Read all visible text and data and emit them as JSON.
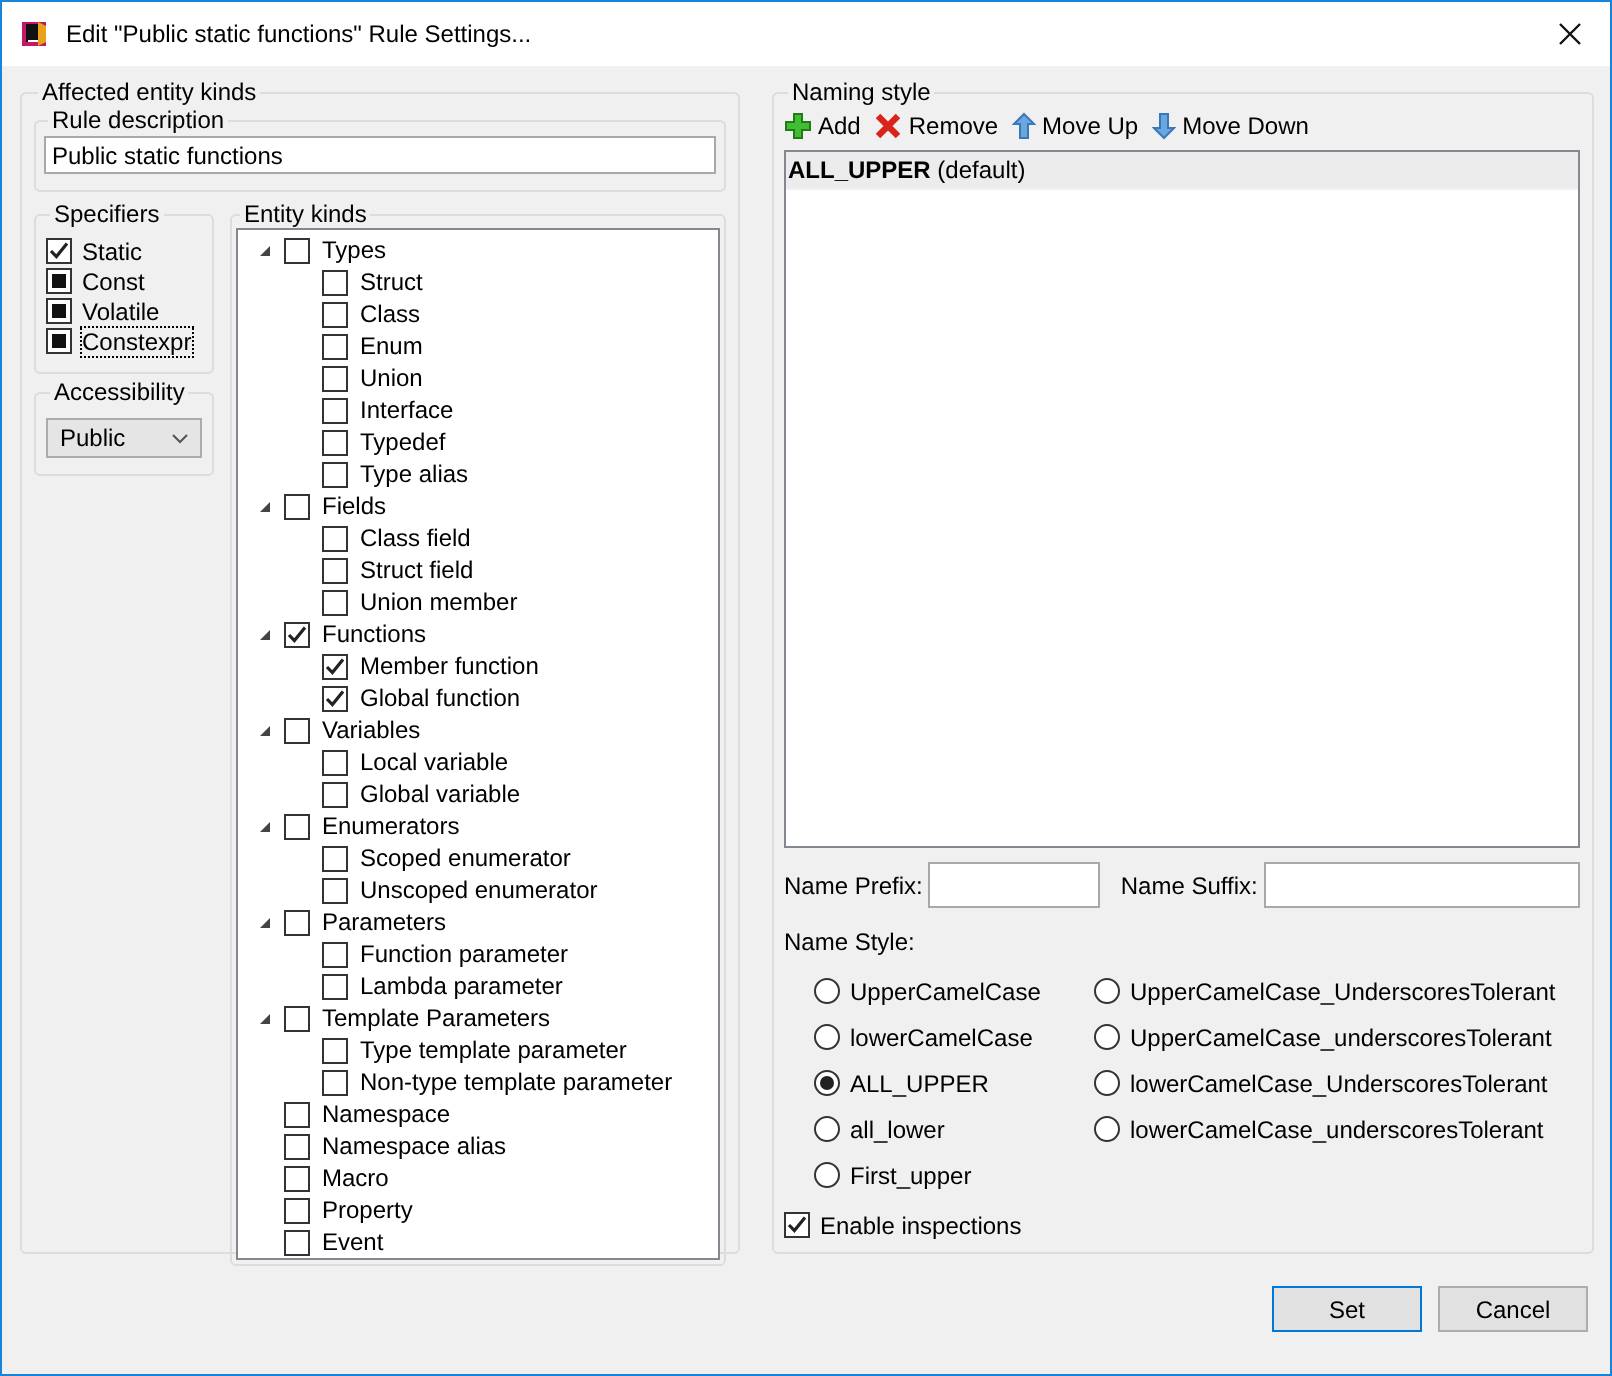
{
  "window": {
    "title": "Edit \"Public static functions\" Rule Settings..."
  },
  "affected": {
    "title": "Affected entity kinds",
    "rule_description": {
      "label": "Rule description",
      "value": "Public static functions"
    },
    "specifiers": {
      "title": "Specifiers",
      "items": [
        {
          "label": "Static",
          "checked": true,
          "focused": false
        },
        {
          "label": "Const",
          "checked": false,
          "indeterminate": true,
          "focused": false
        },
        {
          "label": "Volatile",
          "checked": false,
          "indeterminate": true,
          "focused": false
        },
        {
          "label": "Constexpr",
          "checked": false,
          "indeterminate": true,
          "focused": true
        }
      ]
    },
    "accessibility": {
      "title": "Accessibility",
      "value": "Public"
    },
    "entity_kinds": {
      "title": "Entity kinds",
      "items": [
        {
          "label": "Types",
          "checked": false,
          "expanded": true,
          "children": [
            {
              "label": "Struct",
              "checked": false
            },
            {
              "label": "Class",
              "checked": false
            },
            {
              "label": "Enum",
              "checked": false
            },
            {
              "label": "Union",
              "checked": false
            },
            {
              "label": "Interface",
              "checked": false
            },
            {
              "label": "Typedef",
              "checked": false
            },
            {
              "label": "Type alias",
              "checked": false
            }
          ]
        },
        {
          "label": "Fields",
          "checked": false,
          "expanded": true,
          "children": [
            {
              "label": "Class field",
              "checked": false
            },
            {
              "label": "Struct field",
              "checked": false
            },
            {
              "label": "Union member",
              "checked": false
            }
          ]
        },
        {
          "label": "Functions",
          "checked": true,
          "expanded": true,
          "children": [
            {
              "label": "Member function",
              "checked": true
            },
            {
              "label": "Global function",
              "checked": true
            }
          ]
        },
        {
          "label": "Variables",
          "checked": false,
          "expanded": true,
          "children": [
            {
              "label": "Local variable",
              "checked": false
            },
            {
              "label": "Global variable",
              "checked": false
            }
          ]
        },
        {
          "label": "Enumerators",
          "checked": false,
          "expanded": true,
          "children": [
            {
              "label": "Scoped enumerator",
              "checked": false
            },
            {
              "label": "Unscoped enumerator",
              "checked": false
            }
          ]
        },
        {
          "label": "Parameters",
          "checked": false,
          "expanded": true,
          "children": [
            {
              "label": "Function parameter",
              "checked": false
            },
            {
              "label": "Lambda parameter",
              "checked": false
            }
          ]
        },
        {
          "label": "Template Parameters",
          "checked": false,
          "expanded": true,
          "children": [
            {
              "label": "Type template parameter",
              "checked": false
            },
            {
              "label": "Non-type template parameter",
              "checked": false
            }
          ]
        },
        {
          "label": "Namespace",
          "checked": false
        },
        {
          "label": "Namespace alias",
          "checked": false
        },
        {
          "label": "Macro",
          "checked": false
        },
        {
          "label": "Property",
          "checked": false
        },
        {
          "label": "Event",
          "checked": false
        }
      ]
    }
  },
  "naming": {
    "title": "Naming style",
    "toolbar": [
      {
        "label": "Add",
        "kind": "add"
      },
      {
        "label": "Remove",
        "kind": "remove"
      },
      {
        "label": "Move Up",
        "kind": "up"
      },
      {
        "label": "Move Down",
        "kind": "down"
      }
    ],
    "styles": [
      {
        "name": "ALL_UPPER",
        "note": "(default)",
        "selected": true
      }
    ],
    "prefix": {
      "label": "Name Prefix:"
    },
    "suffix": {
      "label": "Name Suffix:"
    },
    "name_style": {
      "label": "Name Style:",
      "options": [
        {
          "label": "UpperCamelCase",
          "selected": false
        },
        {
          "label": "lowerCamelCase",
          "selected": false
        },
        {
          "label": "ALL_UPPER",
          "selected": true
        },
        {
          "label": "all_lower",
          "selected": false
        },
        {
          "label": "First_upper",
          "selected": false
        },
        {
          "label": "UpperCamelCase_UnderscoresTolerant",
          "selected": false
        },
        {
          "label": "UpperCamelCase_underscoresTolerant",
          "selected": false
        },
        {
          "label": "lowerCamelCase_UnderscoresTolerant",
          "selected": false
        },
        {
          "label": "lowerCamelCase_underscoresTolerant",
          "selected": false
        }
      ]
    },
    "enable_inspections": {
      "label": "Enable inspections",
      "checked": true
    }
  },
  "buttons": [
    {
      "label": "Set",
      "default": true
    },
    {
      "label": "Cancel",
      "default": false
    }
  ]
}
